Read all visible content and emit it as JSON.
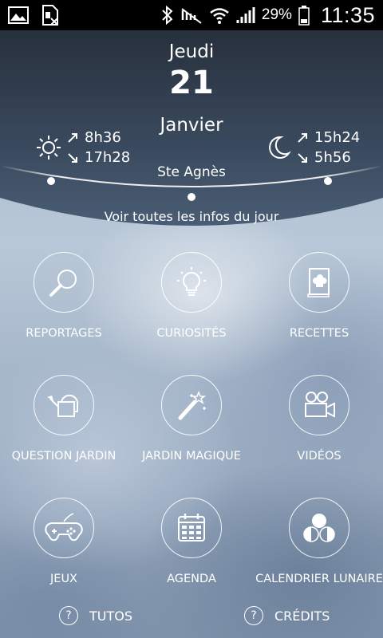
{
  "status_bar": {
    "battery_percent": "29%",
    "time": "11:35",
    "icons": [
      "image-icon",
      "sim-icon",
      "bluetooth-icon",
      "mute-icon",
      "wifi-icon",
      "signal-icon",
      "battery-icon"
    ]
  },
  "date": {
    "day_name": "Jeudi",
    "day_number": "21",
    "month": "Janvier"
  },
  "sun": {
    "icon": "sun-icon",
    "rise": "8h36",
    "set": "17h28"
  },
  "moon": {
    "icon": "moon-icon",
    "rise": "15h24",
    "set": "5h56"
  },
  "saint": "Ste Agnès",
  "day_info_link": "Voir toutes les infos du jour",
  "menu": [
    {
      "label": "REPORTAGES",
      "icon": "magnifier-icon"
    },
    {
      "label": "CURIOSITÉS",
      "icon": "lightbulb-icon"
    },
    {
      "label": "RECETTES",
      "icon": "recipe-book-icon"
    },
    {
      "label": "QUESTION JARDIN",
      "icon": "watering-can-icon"
    },
    {
      "label": "JARDIN MAGIQUE",
      "icon": "magic-wand-icon"
    },
    {
      "label": "VIDÉOS",
      "icon": "video-camera-icon"
    },
    {
      "label": "JEUX",
      "icon": "gamepad-icon"
    },
    {
      "label": "AGENDA",
      "icon": "calendar-icon"
    },
    {
      "label": "CALENDRIER LUNAIRE",
      "icon": "moon-phases-icon"
    }
  ],
  "footer": {
    "tutos_label": "TUTOS",
    "credits_label": "CRÉDITS"
  }
}
